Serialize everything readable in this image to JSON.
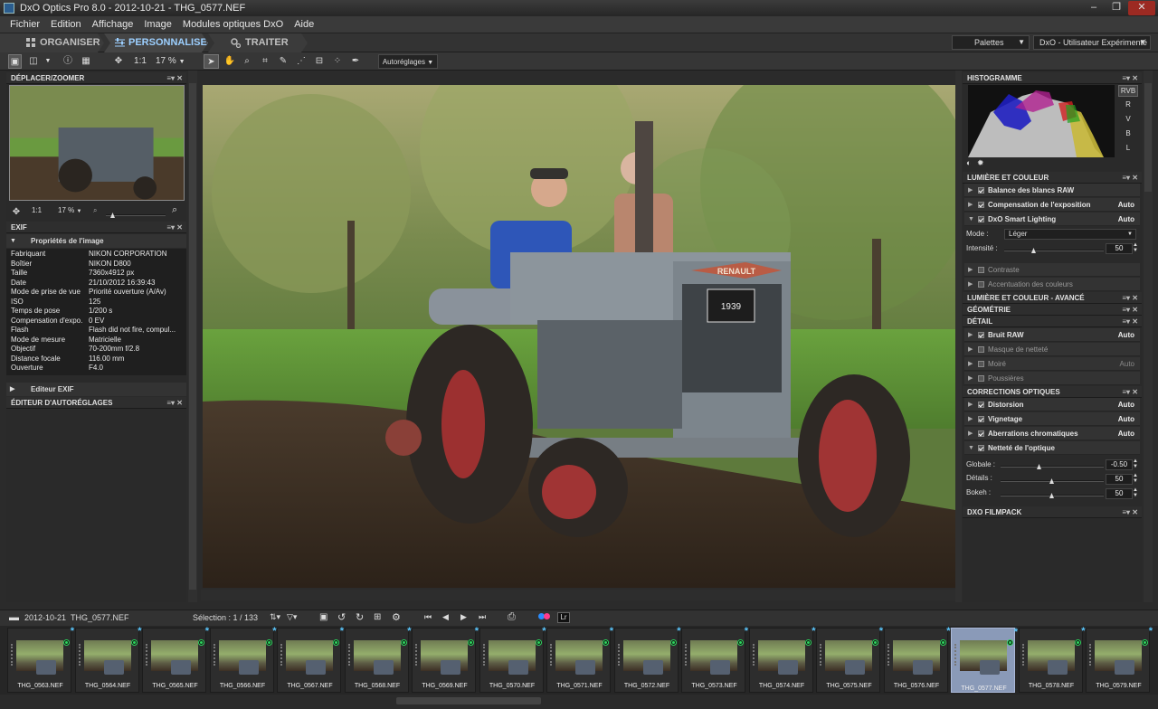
{
  "window": {
    "title": "DxO Optics Pro 8.0 - 2012-10-21 - THG_0577.NEF",
    "min": "‒",
    "max": "❐",
    "close": "✕"
  },
  "menu": [
    "Fichier",
    "Edition",
    "Affichage",
    "Image",
    "Modules optiques DxO",
    "Aide"
  ],
  "modes": {
    "organiser": "ORGANISER",
    "personnaliser": "PERSONNALISER",
    "traiter": "TRAITER",
    "active": "PERSONNALISER"
  },
  "palettes": {
    "label": "Palettes",
    "workspace": "DxO - Utilisateur Expérimenté"
  },
  "toolbar": {
    "ratio": "1:1",
    "zoom": "17 %",
    "preset": "Autoréglages"
  },
  "left": {
    "navigator": {
      "title": "DÉPLACER/ZOOMER",
      "ratio": "1:1",
      "zoom": "17 %"
    },
    "exif": {
      "title": "EXIF",
      "section": "Propriétés de l'image",
      "rows": [
        {
          "k": "Fabriquant",
          "v": "NIKON CORPORATION"
        },
        {
          "k": "Boîtier",
          "v": "NIKON D800"
        },
        {
          "k": "Taille",
          "v": "7360x4912 px"
        },
        {
          "k": "Date",
          "v": "21/10/2012 16:39:43"
        },
        {
          "k": "Mode de prise de vue",
          "v": "Priorité ouverture (A/Av)"
        },
        {
          "k": "ISO",
          "v": "125"
        },
        {
          "k": "Temps de pose",
          "v": "1/200 s"
        },
        {
          "k": "Compensation d'expo.",
          "v": "0 EV"
        },
        {
          "k": "Flash",
          "v": "Flash did not fire, compul..."
        },
        {
          "k": "Mode de mesure",
          "v": "Matricielle"
        },
        {
          "k": "Objectif",
          "v": "70-200mm f/2.8"
        },
        {
          "k": "Distance focale",
          "v": "116.00 mm"
        },
        {
          "k": "Ouverture",
          "v": "F4.0"
        }
      ],
      "editor": "Editeur EXIF"
    },
    "presets": {
      "title": "ÉDITEUR D'AUTORÉGLAGES"
    }
  },
  "right": {
    "histogram": {
      "title": "HISTOGRAMME",
      "channels": [
        "RVB",
        "R",
        "V",
        "B",
        "L"
      ]
    },
    "light": {
      "title": "LUMIÈRE ET COULEUR",
      "items": [
        {
          "label": "Balance des blancs RAW",
          "auto": "",
          "on": true
        },
        {
          "label": "Compensation de l'exposition",
          "auto": "Auto",
          "on": true
        },
        {
          "label": "DxO Smart Lighting",
          "auto": "Auto",
          "on": true
        }
      ],
      "mode_label": "Mode :",
      "mode_value": "Léger",
      "intensity_label": "Intensité :",
      "intensity_value": "50",
      "more": [
        {
          "label": "Contraste",
          "on": false
        },
        {
          "label": "Accentuation des couleurs",
          "on": false
        }
      ]
    },
    "advanced": {
      "title": "LUMIÈRE ET COULEUR - AVANCÉ"
    },
    "geometry": {
      "title": "GÉOMÉTRIE"
    },
    "detail": {
      "title": "DÉTAIL",
      "items": [
        {
          "label": "Bruit RAW",
          "auto": "Auto",
          "on": true
        },
        {
          "label": "Masque de netteté",
          "auto": "",
          "on": false
        },
        {
          "label": "Moiré",
          "auto": "Auto",
          "on": false
        },
        {
          "label": "Poussières",
          "auto": "",
          "on": false
        }
      ]
    },
    "optical": {
      "title": "CORRECTIONS OPTIQUES",
      "items": [
        {
          "label": "Distorsion",
          "auto": "Auto",
          "on": true
        },
        {
          "label": "Vignetage",
          "auto": "Auto",
          "on": true
        },
        {
          "label": "Aberrations chromatiques",
          "auto": "Auto",
          "on": true
        },
        {
          "label": "Netteté de l'optique",
          "auto": "",
          "on": true
        }
      ],
      "globale_label": "Globale :",
      "globale_value": "-0.50",
      "details_label": "Détails :",
      "details_value": "50",
      "bokeh_label": "Bokeh :",
      "bokeh_value": "50"
    },
    "filmpack": {
      "title": "DXO FILMPACK"
    }
  },
  "filmbar": {
    "folder": "2012-10-21",
    "file": "THG_0577.NEF",
    "selection": "Sélection : 1 / 133",
    "lr": "Lr"
  },
  "film": [
    "THG_0563.NEF",
    "THG_0564.NEF",
    "THG_0565.NEF",
    "THG_0566.NEF",
    "THG_0567.NEF",
    "THG_0568.NEF",
    "THG_0569.NEF",
    "THG_0570.NEF",
    "THG_0571.NEF",
    "THG_0572.NEF",
    "THG_0573.NEF",
    "THG_0574.NEF",
    "THG_0575.NEF",
    "THG_0576.NEF",
    "THG_0577.NEF",
    "THG_0578.NEF",
    "THG_0579.NEF"
  ],
  "selected_file": "THG_0577.NEF",
  "photo": {
    "tractor_plate": "RENAULT",
    "tractor_sign": "1939"
  },
  "colors": {
    "accent": "#9ccfff",
    "selected_thumb": "#8a9ab8",
    "star": "#5bc8ff",
    "status_dot": "#2cd45c"
  }
}
